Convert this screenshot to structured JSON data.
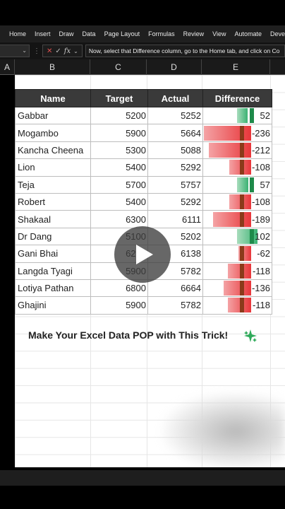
{
  "ribbon": {
    "tabs": [
      "Home",
      "Insert",
      "Draw",
      "Data",
      "Page Layout",
      "Formulas",
      "Review",
      "View",
      "Automate",
      "Devel"
    ]
  },
  "formula_bar": {
    "text": "Now, select that Difference column, go to the Home tab, and click on Co"
  },
  "columns": [
    "A",
    "B",
    "C",
    "D",
    "E"
  ],
  "table": {
    "headers": [
      "Name",
      "Target",
      "Actual",
      "Difference"
    ],
    "rows": [
      {
        "name": "Gabbar",
        "target": "5200",
        "actual": "5252",
        "diff": "52",
        "value": 52
      },
      {
        "name": "Mogambo",
        "target": "5900",
        "actual": "5664",
        "diff": "-236",
        "value": -236
      },
      {
        "name": "Kancha Cheena",
        "target": "5300",
        "actual": "5088",
        "diff": "-212",
        "value": -212
      },
      {
        "name": "Lion",
        "target": "5400",
        "actual": "5292",
        "diff": "-108",
        "value": -108
      },
      {
        "name": "Teja",
        "target": "5700",
        "actual": "5757",
        "diff": "57",
        "value": 57
      },
      {
        "name": "Robert",
        "target": "5400",
        "actual": "5292",
        "diff": "-108",
        "value": -108
      },
      {
        "name": "Shakaal",
        "target": "6300",
        "actual": "6111",
        "diff": "-189",
        "value": -189
      },
      {
        "name": "Dr Dang",
        "target": "5100",
        "actual": "5202",
        "diff": "102",
        "value": 102
      },
      {
        "name": "Gani Bhai",
        "target": "6200",
        "actual": "6138",
        "diff": "-62",
        "value": -62
      },
      {
        "name": "Langda Tyagi",
        "target": "5900",
        "actual": "5782",
        "diff": "-118",
        "value": -118
      },
      {
        "name": "Lotiya Pathan",
        "target": "6800",
        "actual": "6664",
        "diff": "-136",
        "value": -136
      },
      {
        "name": "Ghajini",
        "target": "5900",
        "actual": "5782",
        "diff": "-118",
        "value": -118
      }
    ]
  },
  "caption": "Make Your Excel Data POP with This Trick!",
  "colors": {
    "header_bg": "#3a3a3a",
    "negative": "#e8363a",
    "negative_light": "#f4a3a5",
    "positive": "#3bb273",
    "positive_light": "#a8dcbc",
    "dark_marker": "#8b3a1a"
  },
  "icons": {
    "play": "play-icon",
    "sparkle": "sparkle-icon",
    "cancel": "x-icon",
    "enter": "check-icon",
    "function": "fx-icon"
  }
}
